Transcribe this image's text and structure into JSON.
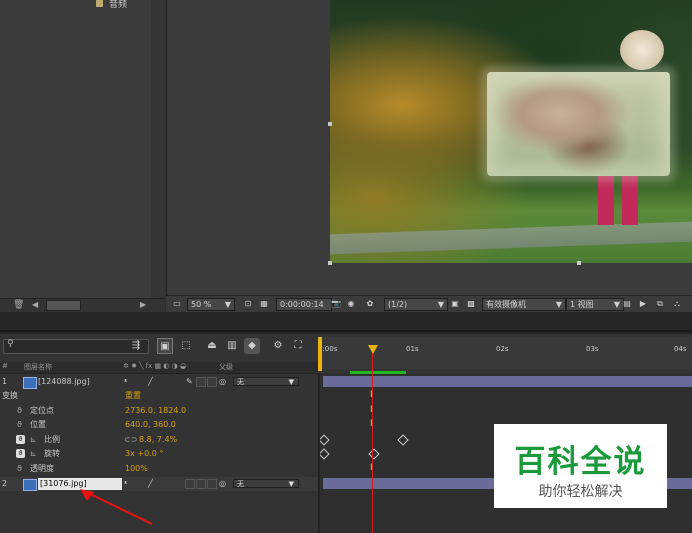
{
  "project": {
    "item_label": "音频",
    "item_color": "#bfa86e"
  },
  "viewer_toolbar": {
    "zoom": "50 %",
    "timecode": "0:00:00:14",
    "resolution": "(1/2)",
    "camera": "有效摄像机",
    "views": "1 视图"
  },
  "timeline": {
    "column_name_header": "图层名称",
    "column_parent_header": "父级",
    "ruler_labels": [
      "0:00s",
      "01s",
      "02s",
      "03s",
      "04s"
    ],
    "layers": [
      {
        "num": "1",
        "name": "[124088.jpg]",
        "mode": "无",
        "transform_label": "变换",
        "reset_label": "重置",
        "properties": [
          {
            "name": "定位点",
            "value": "2736.0, 1824.0"
          },
          {
            "name": "位置",
            "value": "640.0, 360.0"
          },
          {
            "name": "比例",
            "value": "8.8, 7.4%"
          },
          {
            "name": "旋转",
            "value": "3x +0.0 °"
          },
          {
            "name": "透明度",
            "value": "100%"
          }
        ]
      },
      {
        "num": "2",
        "name": "[31076.jpg]",
        "mode": "无"
      }
    ]
  },
  "watermark": {
    "title": "百科全说",
    "subtitle": "助你轻松解决"
  },
  "colors": {
    "accent_value": "#d6a012",
    "playhead": "#d02020",
    "work_area": "#1fb51f",
    "watermark_green": "#1a9a3a"
  }
}
